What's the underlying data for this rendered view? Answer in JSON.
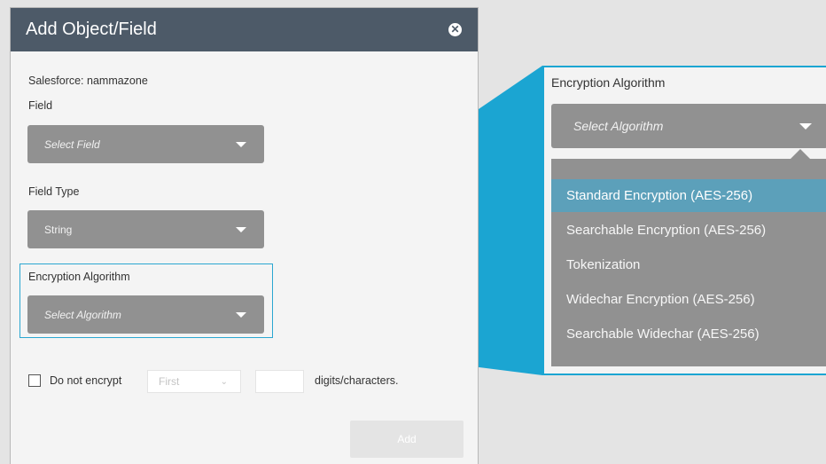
{
  "dialog": {
    "title": "Add Object/Field",
    "source_text": "Salesforce: nammazone",
    "field_label": "Field",
    "field_placeholder": "Select Field",
    "field_type_label": "Field Type",
    "field_type_value": "String",
    "encryption_label": "Encryption Algorithm",
    "encryption_placeholder": "Select Algorithm",
    "do_not_encrypt_label": "Do not encrypt",
    "position_select_value": "First",
    "digits_label": "digits/characters.",
    "add_label": "Add"
  },
  "zoom": {
    "label": "Encryption Algorithm",
    "placeholder": "Select Algorithm",
    "options": [
      "Standard Encryption (AES-256)",
      "Searchable Encryption (AES-256)",
      "Tokenization",
      "Widechar Encryption (AES-256)",
      "Searchable Widechar (AES-256)"
    ],
    "selected_option": "Standard Encryption (AES-256)"
  },
  "colors": {
    "header": "#4d5a68",
    "accent": "#1ba5d2",
    "select_bg": "#919191",
    "selected_option": "#5ca0ba"
  },
  "icons": {
    "close": "close-circle-icon",
    "caret": "caret-down-icon",
    "chevron": "chevron-down-icon"
  }
}
